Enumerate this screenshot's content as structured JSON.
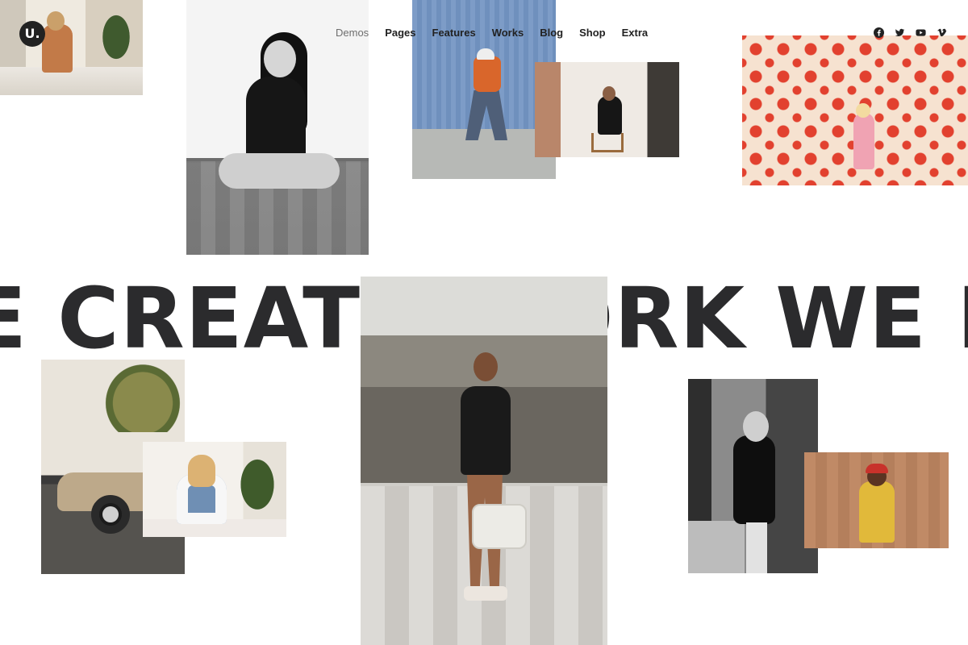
{
  "header": {
    "logo": {
      "text": "U.",
      "icon": "brand-logo"
    },
    "nav": [
      {
        "label": "Demos",
        "active": true
      },
      {
        "label": "Pages",
        "active": false
      },
      {
        "label": "Features",
        "active": false
      },
      {
        "label": "Works",
        "active": false
      },
      {
        "label": "Blog",
        "active": false
      },
      {
        "label": "Shop",
        "active": false
      },
      {
        "label": "Extra",
        "active": false
      }
    ],
    "social": [
      "facebook-icon",
      "twitter-icon",
      "youtube-icon",
      "vimeo-icon"
    ]
  },
  "hero": {
    "marquee_text": "E CREATE WORK WE LOVE"
  },
  "colors": {
    "text": "#2b2b2d",
    "active_nav": "#6e6e6e",
    "background": "#ffffff",
    "accent_dots": "#e2412f"
  }
}
